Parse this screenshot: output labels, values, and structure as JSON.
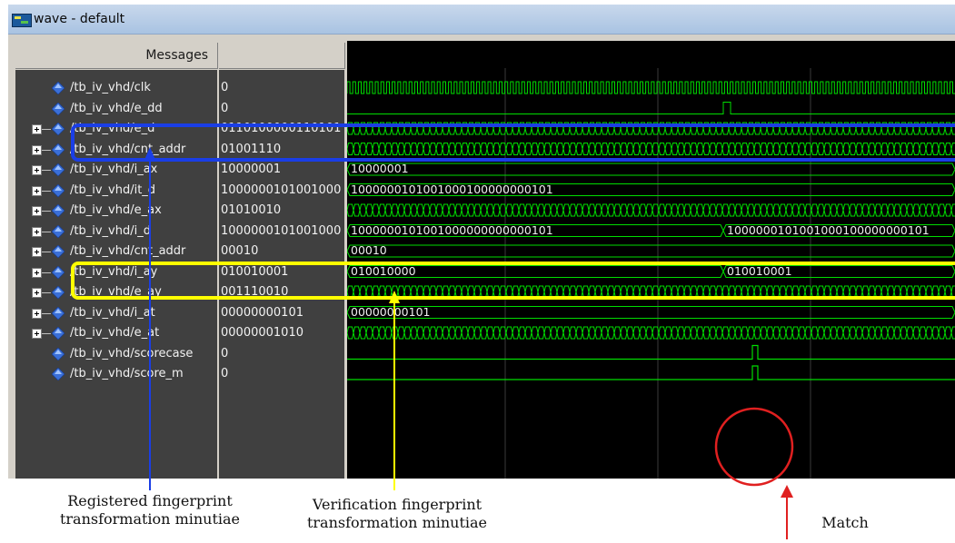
{
  "window": {
    "title": "wave - default"
  },
  "header": {
    "messages_label": "Messages"
  },
  "signals": [
    {
      "name": "/tb_iv_vhd/clk",
      "value": "0",
      "expandable": false,
      "wave": "clock",
      "segments": []
    },
    {
      "name": "/tb_iv_vhd/e_dd",
      "value": "0",
      "expandable": false,
      "wave": "e_dd_pulse",
      "segments": []
    },
    {
      "name": "/tb_iv_vhd/e_d",
      "value": "0110100000110101",
      "expandable": true,
      "wave": "bus_dense",
      "segments": []
    },
    {
      "name": "/tb_iv_vhd/cnt_addr",
      "value": "01001110",
      "expandable": true,
      "wave": "bus_dense",
      "segments": []
    },
    {
      "name": "/tb_iv_vhd/i_ax",
      "value": "10000001",
      "expandable": true,
      "wave": "bus_segments",
      "segments": [
        "10000001"
      ]
    },
    {
      "name": "/tb_iv_vhd/it_d",
      "value": "1000000101001000",
      "expandable": true,
      "wave": "bus_segments",
      "segments": [
        "1000000101001000100000000101"
      ]
    },
    {
      "name": "/tb_iv_vhd/e_ax",
      "value": "01010010",
      "expandable": true,
      "wave": "bus_dense",
      "segments": []
    },
    {
      "name": "/tb_iv_vhd/i_d",
      "value": "1000000101001000",
      "expandable": true,
      "wave": "bus_segments",
      "segments": [
        "1000000101001000000000000101",
        "1000000101001000100000000101"
      ]
    },
    {
      "name": "/tb_iv_vhd/cnt_addr",
      "value": "00010",
      "expandable": true,
      "wave": "bus_segments",
      "segments": [
        "00010"
      ]
    },
    {
      "name": "/tb_iv_vhd/i_ay",
      "value": "010010001",
      "expandable": true,
      "wave": "bus_segments",
      "segments": [
        "010010000",
        "010010001"
      ]
    },
    {
      "name": "/tb_iv_vhd/e_ay",
      "value": "001110010",
      "expandable": true,
      "wave": "bus_dense",
      "segments": []
    },
    {
      "name": "/tb_iv_vhd/i_at",
      "value": "00000000101",
      "expandable": true,
      "wave": "bus_segments",
      "segments": [
        "00000000101"
      ]
    },
    {
      "name": "/tb_iv_vhd/e_at",
      "value": "00000001010",
      "expandable": true,
      "wave": "bus_dense",
      "segments": []
    },
    {
      "name": "/tb_iv_vhd/scorecase",
      "value": "0",
      "expandable": false,
      "wave": "pulse_bottom",
      "segments": []
    },
    {
      "name": "/tb_iv_vhd/score_m",
      "value": "0",
      "expandable": false,
      "wave": "pulse_bottom",
      "segments": []
    }
  ],
  "annotations": {
    "registered_label": "Registered fingerprint transformation minutiae",
    "verification_label": "Verification fingerprint transformation minutiae",
    "match_label": "Match"
  },
  "colors": {
    "wave_green": "#00dd00",
    "registered_highlight": "#1a3ee6",
    "verification_highlight": "#ffff00",
    "match_circle": "#e02020",
    "diamond_blue": "#3a6fd8"
  }
}
